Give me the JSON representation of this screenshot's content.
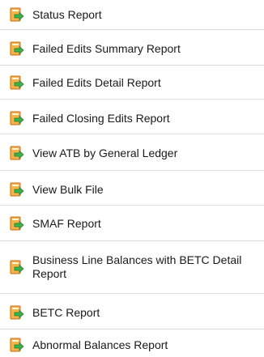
{
  "colors": {
    "separator": "#dcdcdc",
    "icon_doc": "#e88a2e",
    "icon_arrow": "#3aa83a"
  },
  "menu": {
    "items": [
      {
        "label": "Status Report",
        "icon": "report-export-icon"
      },
      {
        "label": "Failed Edits Summary Report",
        "icon": "report-export-icon"
      },
      {
        "label": "Failed Edits Detail Report",
        "icon": "report-export-icon"
      },
      {
        "label": "Failed Closing Edits Report",
        "icon": "report-export-icon"
      },
      {
        "label": "View ATB by General Ledger",
        "icon": "report-export-icon"
      },
      {
        "label": "View Bulk File",
        "icon": "report-export-icon"
      },
      {
        "label": "SMAF Report",
        "icon": "report-export-icon"
      },
      {
        "label": "Business Line Balances with BETC Detail Report",
        "icon": "report-export-icon"
      },
      {
        "label": "BETC Report",
        "icon": "report-export-icon"
      },
      {
        "label": "Abnormal Balances Report",
        "icon": "report-export-icon"
      }
    ]
  }
}
